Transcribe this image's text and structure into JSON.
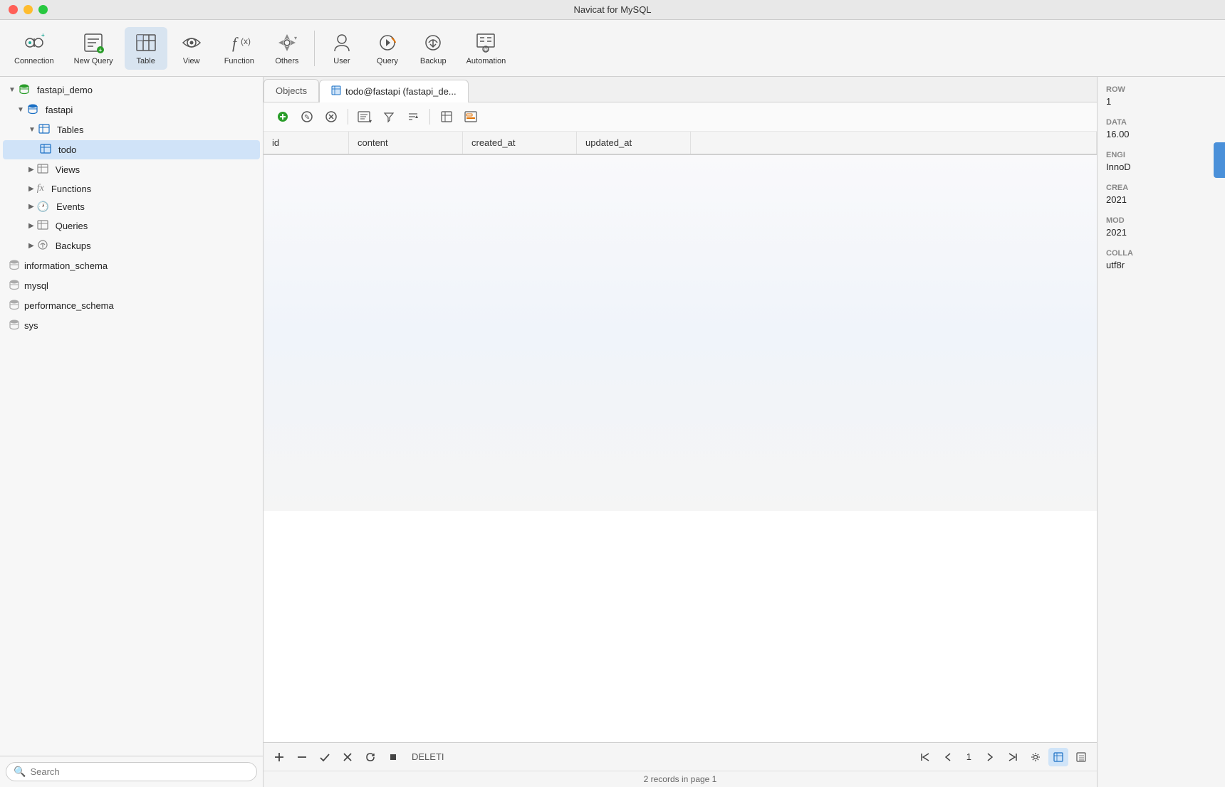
{
  "window": {
    "title": "Navicat for MySQL"
  },
  "toolbar": {
    "items": [
      {
        "id": "connection",
        "label": "Connection",
        "icon": "🔌"
      },
      {
        "id": "new-query",
        "label": "New Query",
        "icon": "📝"
      },
      {
        "id": "table",
        "label": "Table",
        "icon": "📋"
      },
      {
        "id": "view",
        "label": "View",
        "icon": "👁"
      },
      {
        "id": "function",
        "label": "Function",
        "icon": "𝑓"
      },
      {
        "id": "others",
        "label": "Others",
        "icon": "⚙"
      },
      {
        "id": "user",
        "label": "User",
        "icon": "👤"
      },
      {
        "id": "query",
        "label": "Query",
        "icon": "🔄"
      },
      {
        "id": "backup",
        "label": "Backup",
        "icon": "💾"
      },
      {
        "id": "automation",
        "label": "Automation",
        "icon": "⏱"
      }
    ]
  },
  "sidebar": {
    "databases": [
      {
        "id": "fastapi_demo",
        "name": "fastapi_demo",
        "expanded": true,
        "children": [
          {
            "id": "fastapi",
            "name": "fastapi",
            "expanded": true,
            "children": [
              {
                "id": "tables",
                "name": "Tables",
                "expanded": true,
                "children": [
                  {
                    "id": "todo",
                    "name": "todo",
                    "selected": true
                  }
                ]
              },
              {
                "id": "views",
                "name": "Views",
                "expanded": false
              },
              {
                "id": "functions",
                "name": "Functions",
                "expanded": false
              },
              {
                "id": "events",
                "name": "Events",
                "expanded": false
              },
              {
                "id": "queries",
                "name": "Queries",
                "expanded": false
              },
              {
                "id": "backups",
                "name": "Backups",
                "expanded": false
              }
            ]
          }
        ]
      },
      {
        "id": "information_schema",
        "name": "information_schema"
      },
      {
        "id": "mysql",
        "name": "mysql"
      },
      {
        "id": "performance_schema",
        "name": "performance_schema"
      },
      {
        "id": "sys",
        "name": "sys"
      }
    ],
    "search_placeholder": "Search"
  },
  "tabs": [
    {
      "id": "objects",
      "label": "Objects",
      "active": false
    },
    {
      "id": "todo-table",
      "label": "todo@fastapi (fastapi_de...",
      "active": true,
      "icon": "📋"
    }
  ],
  "table": {
    "columns": [
      "id",
      "content",
      "created_at",
      "updated_at"
    ],
    "rows": []
  },
  "bottom_bar": {
    "delete_label": "DELETI",
    "page": "1",
    "records_info": "2 records in page 1"
  },
  "right_panel": {
    "sections": [
      {
        "label": "Row",
        "value": "1"
      },
      {
        "label": "Data",
        "value": "16.00"
      },
      {
        "label": "Engi",
        "value": "InnoD"
      },
      {
        "label": "Crea",
        "value": "2021"
      },
      {
        "label": "Mod",
        "value": "2021"
      },
      {
        "label": "Colla",
        "value": "utf8r"
      }
    ]
  }
}
